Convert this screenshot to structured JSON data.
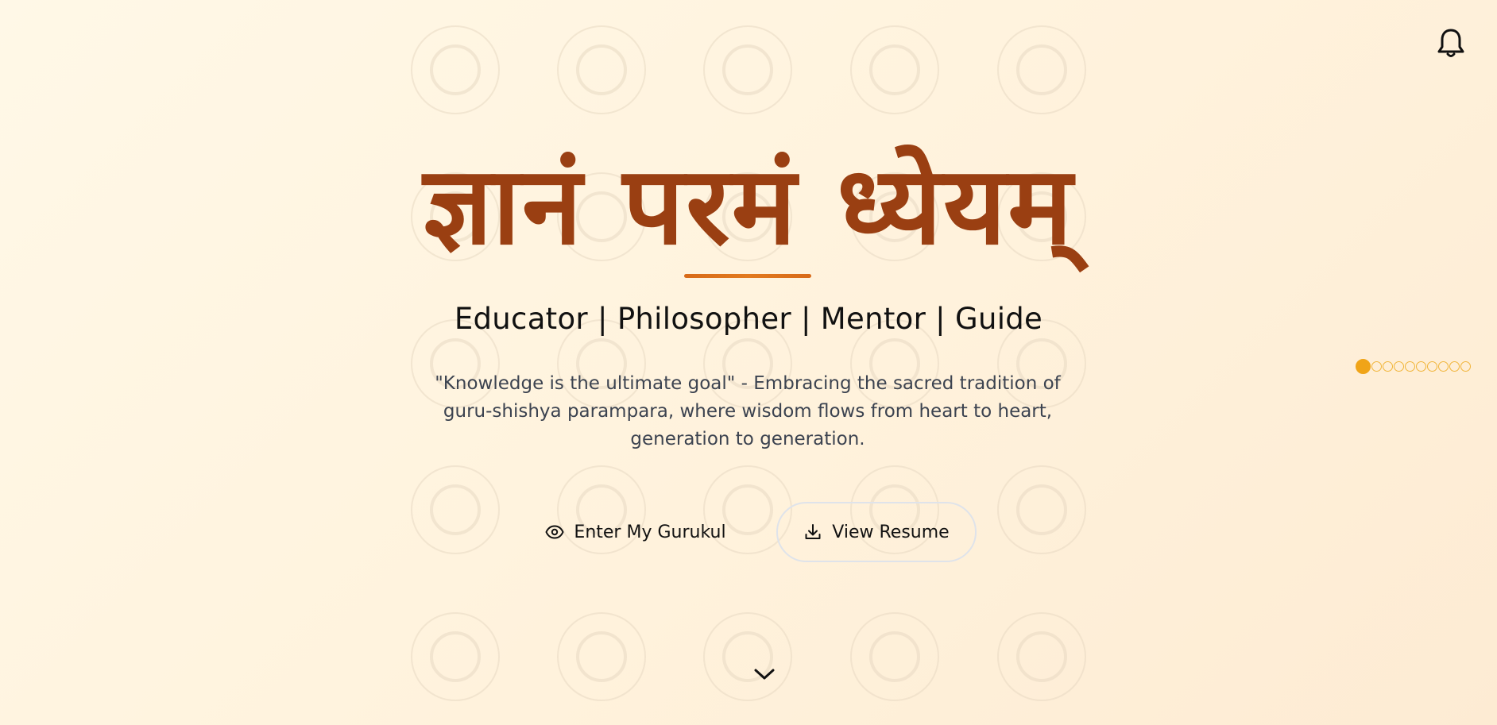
{
  "header": {
    "notification_icon": "bell-icon"
  },
  "hero": {
    "title": "ज्ञानं परमं ध्येयम्",
    "subtitle": "Educator | Philosopher | Mentor | Guide",
    "quote": "\"Knowledge is the ultimate goal\" - Embracing the sacred tradition of guru-shishya parampara, where wisdom flows from heart to heart, generation to generation.",
    "accent_color": "#9a3f12",
    "underline_color": "#d86a18"
  },
  "actions": {
    "enter_label": "Enter My Gurukul",
    "enter_icon": "eye-icon",
    "resume_label": "View Resume",
    "resume_icon": "download-icon"
  },
  "navigation": {
    "dot_count": 10,
    "active_dot": 1,
    "dot_color": "#f0a418",
    "scroll_icon": "chevron-down-icon"
  }
}
